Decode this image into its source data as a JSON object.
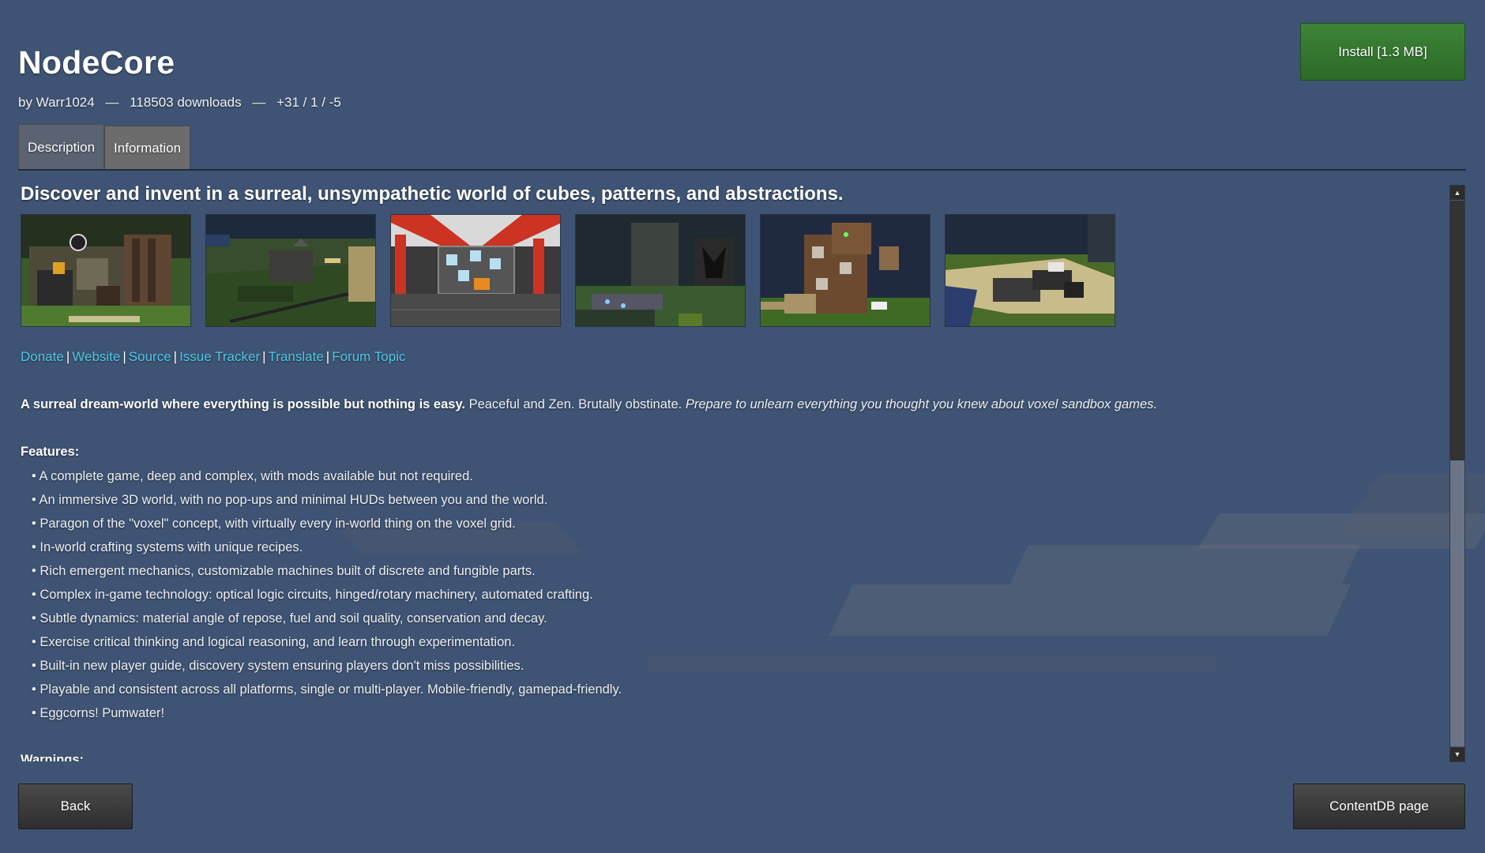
{
  "package": {
    "title": "NodeCore",
    "author": "by Warr1024",
    "downloads": "118503 downloads",
    "rating": "+31 / 1 / -5",
    "separator": "—"
  },
  "install_button": "Install [1.3 MB]",
  "tabs": [
    {
      "label": "Description",
      "active": true
    },
    {
      "label": "Information",
      "active": false
    }
  ],
  "description": {
    "headline": "Discover and invent in a surreal, unsympathetic world of cubes, patterns, and abstractions.",
    "screenshots": [
      {
        "name": "screenshot-1"
      },
      {
        "name": "screenshot-2"
      },
      {
        "name": "screenshot-3"
      },
      {
        "name": "screenshot-4"
      },
      {
        "name": "screenshot-5"
      },
      {
        "name": "screenshot-6"
      }
    ],
    "links": [
      "Donate",
      "Website",
      "Source",
      "Issue Tracker",
      "Translate",
      "Forum Topic"
    ],
    "link_separator": "|",
    "intro_bold": "A surreal dream-world where everything is possible but nothing is easy.",
    "intro_plain": " Peaceful and Zen. Brutally obstinate. ",
    "intro_italic": "Prepare to unlearn everything you thought you knew about voxel sandbox games.",
    "features_heading": "Features:",
    "features": [
      "• A complete game, deep and complex, with mods available but not required.",
      "• An immersive 3D world, with no pop-ups and minimal HUDs between you and the world.",
      "• Paragon of the \"voxel\" concept, with virtually every in-world thing on the voxel grid.",
      "• In-world crafting systems with unique recipes.",
      "• Rich emergent mechanics, customizable machines built of discrete and fungible parts.",
      "• Complex in-game technology: optical logic circuits, hinged/rotary machinery, automated crafting.",
      "• Subtle dynamics: material angle of repose, fuel and soil quality, conservation and decay.",
      "• Exercise critical thinking and logical reasoning, and learn through experimentation.",
      "• Built-in new player guide, discovery system ensuring players don't miss possibilities.",
      "• Playable and consistent across all platforms, single or multi-player. Mobile-friendly, gamepad-friendly.",
      "• Eggcorns! Pumwater!"
    ],
    "warnings_heading": "Warnings:"
  },
  "scrollbar": {
    "position": 0.0,
    "visible_fraction": 0.47
  },
  "footer": {
    "back": "Back",
    "contentdb": "ContentDB page"
  },
  "colors": {
    "background": "#3f5474",
    "install_green": "#3d8438",
    "link": "#4ec8e8"
  }
}
